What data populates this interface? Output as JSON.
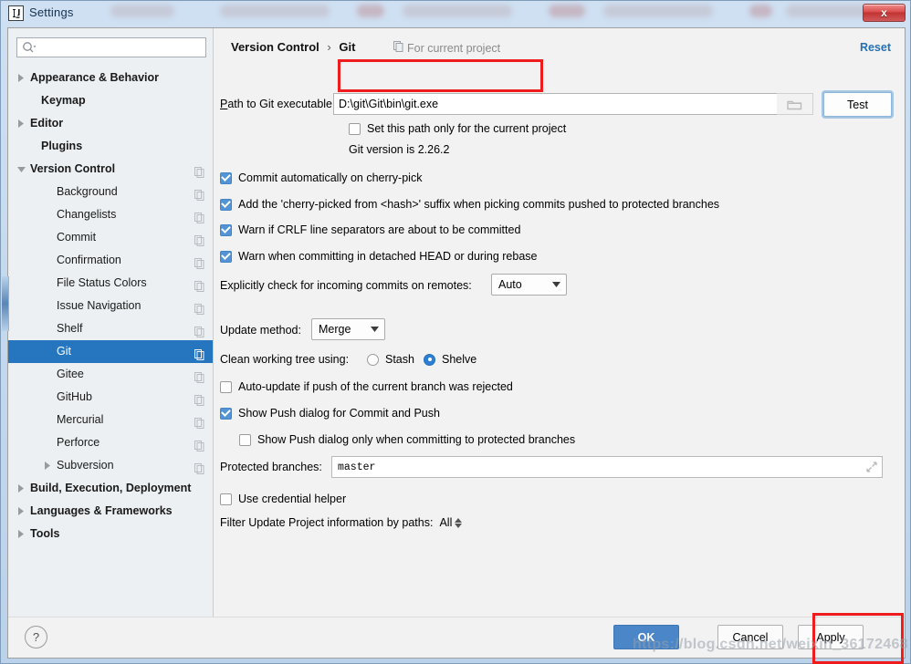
{
  "window": {
    "title": "Settings",
    "app_icon": "intellij-idea-icon",
    "close_label": "x"
  },
  "search": {
    "value": "",
    "placeholder": "",
    "icon": "search-icon"
  },
  "sidebar": {
    "items": [
      {
        "label": "Appearance & Behavior",
        "indent": 24,
        "arrow": "collapsed",
        "bold": true,
        "copy": false,
        "selected": false
      },
      {
        "label": "Keymap",
        "indent": 36,
        "arrow": "none",
        "bold": true,
        "copy": false,
        "selected": false
      },
      {
        "label": "Editor",
        "indent": 24,
        "arrow": "collapsed",
        "bold": true,
        "copy": false,
        "selected": false
      },
      {
        "label": "Plugins",
        "indent": 36,
        "arrow": "none",
        "bold": true,
        "copy": false,
        "selected": false
      },
      {
        "label": "Version Control",
        "indent": 24,
        "arrow": "expanded",
        "bold": true,
        "copy": true,
        "selected": false
      },
      {
        "label": "Background",
        "indent": 53,
        "arrow": "none",
        "bold": false,
        "copy": true,
        "selected": false
      },
      {
        "label": "Changelists",
        "indent": 53,
        "arrow": "none",
        "bold": false,
        "copy": true,
        "selected": false
      },
      {
        "label": "Commit",
        "indent": 53,
        "arrow": "none",
        "bold": false,
        "copy": true,
        "selected": false
      },
      {
        "label": "Confirmation",
        "indent": 53,
        "arrow": "none",
        "bold": false,
        "copy": true,
        "selected": false
      },
      {
        "label": "File Status Colors",
        "indent": 53,
        "arrow": "none",
        "bold": false,
        "copy": true,
        "selected": false
      },
      {
        "label": "Issue Navigation",
        "indent": 53,
        "arrow": "none",
        "bold": false,
        "copy": true,
        "selected": false
      },
      {
        "label": "Shelf",
        "indent": 53,
        "arrow": "none",
        "bold": false,
        "copy": true,
        "selected": false
      },
      {
        "label": "Git",
        "indent": 53,
        "arrow": "none",
        "bold": false,
        "copy": true,
        "selected": true
      },
      {
        "label": "Gitee",
        "indent": 53,
        "arrow": "none",
        "bold": false,
        "copy": true,
        "selected": false
      },
      {
        "label": "GitHub",
        "indent": 53,
        "arrow": "none",
        "bold": false,
        "copy": true,
        "selected": false
      },
      {
        "label": "Mercurial",
        "indent": 53,
        "arrow": "none",
        "bold": false,
        "copy": true,
        "selected": false
      },
      {
        "label": "Perforce",
        "indent": 53,
        "arrow": "none",
        "bold": false,
        "copy": true,
        "selected": false
      },
      {
        "label": "Subversion",
        "indent": 53,
        "arrow": "collapsed",
        "bold": false,
        "copy": true,
        "selected": false
      },
      {
        "label": "Build, Execution, Deployment",
        "indent": 24,
        "arrow": "collapsed",
        "bold": true,
        "copy": false,
        "selected": false
      },
      {
        "label": "Languages & Frameworks",
        "indent": 24,
        "arrow": "collapsed",
        "bold": true,
        "copy": false,
        "selected": false
      },
      {
        "label": "Tools",
        "indent": 24,
        "arrow": "collapsed",
        "bold": true,
        "copy": false,
        "selected": false
      }
    ]
  },
  "main": {
    "breadcrumb_parent": "Version Control",
    "breadcrumb_sep": "›",
    "breadcrumb_current": "Git",
    "scope_note": "For current project",
    "scope_icon": "copy-config-icon",
    "reset_label": "Reset",
    "path_label_prefix": "P",
    "path_label_rest": "ath to Git executable:",
    "path_value": "D:\\git\\Git\\bin\\git.exe",
    "browse_icon": "folder-icon",
    "test_label": "Test",
    "set_path_only_label": "Set this path only for the current project",
    "set_path_only_checked": false,
    "git_version_text": "Git version is 2.26.2",
    "checkboxes": [
      {
        "label": "Commit automatically on cherry-pick",
        "checked": true
      },
      {
        "label": "Add the 'cherry-picked from <hash>' suffix when picking commits pushed to protected branches",
        "checked": true
      },
      {
        "label": "Warn if CRLF line separators are about to be committed",
        "checked": true
      },
      {
        "label": "Warn when committing in detached HEAD or during rebase",
        "checked": true
      }
    ],
    "incoming_label": "Explicitly check for incoming commits on remotes:",
    "incoming_value": "Auto",
    "update_method_label": "Update method:",
    "update_method_value": "Merge",
    "clean_tree_label": "Clean working tree using:",
    "clean_tree_option_stash": "Stash",
    "clean_tree_option_shelve": "Shelve",
    "clean_tree_selected": "Shelve",
    "auto_update_label": "Auto-update if push of the current branch was rejected",
    "auto_update_checked": false,
    "show_push_label": "Show Push dialog for Commit and Push",
    "show_push_checked": true,
    "show_push_protected_label": "Show Push dialog only when committing to protected branches",
    "show_push_protected_checked": false,
    "protected_branches_label": "Protected branches:",
    "protected_branches_value": "master",
    "expand_icon": "expand-diagonal-icon",
    "credential_helper_label": "Use credential helper",
    "credential_helper_checked": false,
    "filter_paths_label": "Filter Update Project information by paths:",
    "filter_paths_value": "All"
  },
  "footer": {
    "help_label": "?",
    "ok_label": "OK",
    "cancel_label": "Cancel",
    "apply_label": "Apply"
  },
  "watermark": {
    "text": "https://blog.csdn.net/weixin_36172468"
  },
  "colors": {
    "accent_blue": "#2675bf",
    "ok_button": "#4a86c8",
    "link_blue": "#2470b3",
    "checkbox_checked": "#5294d6",
    "annotation_red": "#ee1c1c",
    "sidebar_bg": "#ecf0f3",
    "panel_bg": "#f2f2f2"
  }
}
